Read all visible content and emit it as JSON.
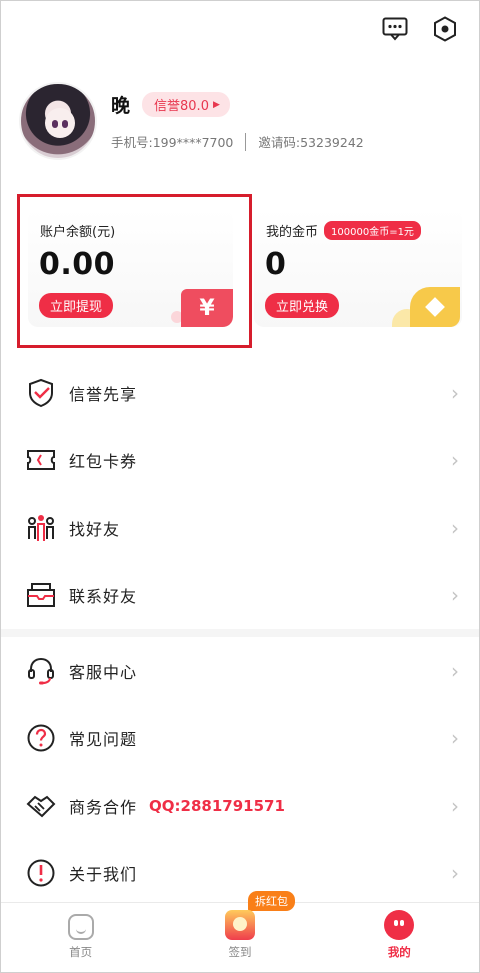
{
  "header": {
    "icons": [
      "message-icon",
      "settings-icon"
    ]
  },
  "profile": {
    "name": "晚",
    "credit_badge": "信誉80.0",
    "phone": "手机号:199****7700",
    "invite_code": "邀请码:53239242"
  },
  "cards": {
    "balance": {
      "label": "账户余额(元)",
      "value": "0.00",
      "button": "立即提现",
      "tile": "¥"
    },
    "coins": {
      "label": "我的金币",
      "rate": "100000金币=1元",
      "value": "0",
      "button": "立即兑换"
    }
  },
  "menu": {
    "group1": [
      {
        "label": "信誉先享",
        "icon": "shield-check-icon"
      },
      {
        "label": "红包卡券",
        "icon": "ticket-icon"
      },
      {
        "label": "找好友",
        "icon": "people-icon"
      },
      {
        "label": "联系好友",
        "icon": "mail-icon"
      }
    ],
    "group2": [
      {
        "label": "客服中心",
        "icon": "headset-icon"
      },
      {
        "label": "常见问题",
        "icon": "question-icon"
      },
      {
        "label": "商务合作",
        "icon": "handshake-icon",
        "extra": "QQ:2881791571"
      },
      {
        "label": "关于我们",
        "icon": "info-icon"
      }
    ]
  },
  "tabbar": {
    "home": "首页",
    "signin": "签到",
    "signin_badge": "拆红包",
    "mine": "我的"
  },
  "colors": {
    "accent": "#ef2e46",
    "highlight_border": "#d61d2c",
    "badge_orange": "#f97f18"
  }
}
